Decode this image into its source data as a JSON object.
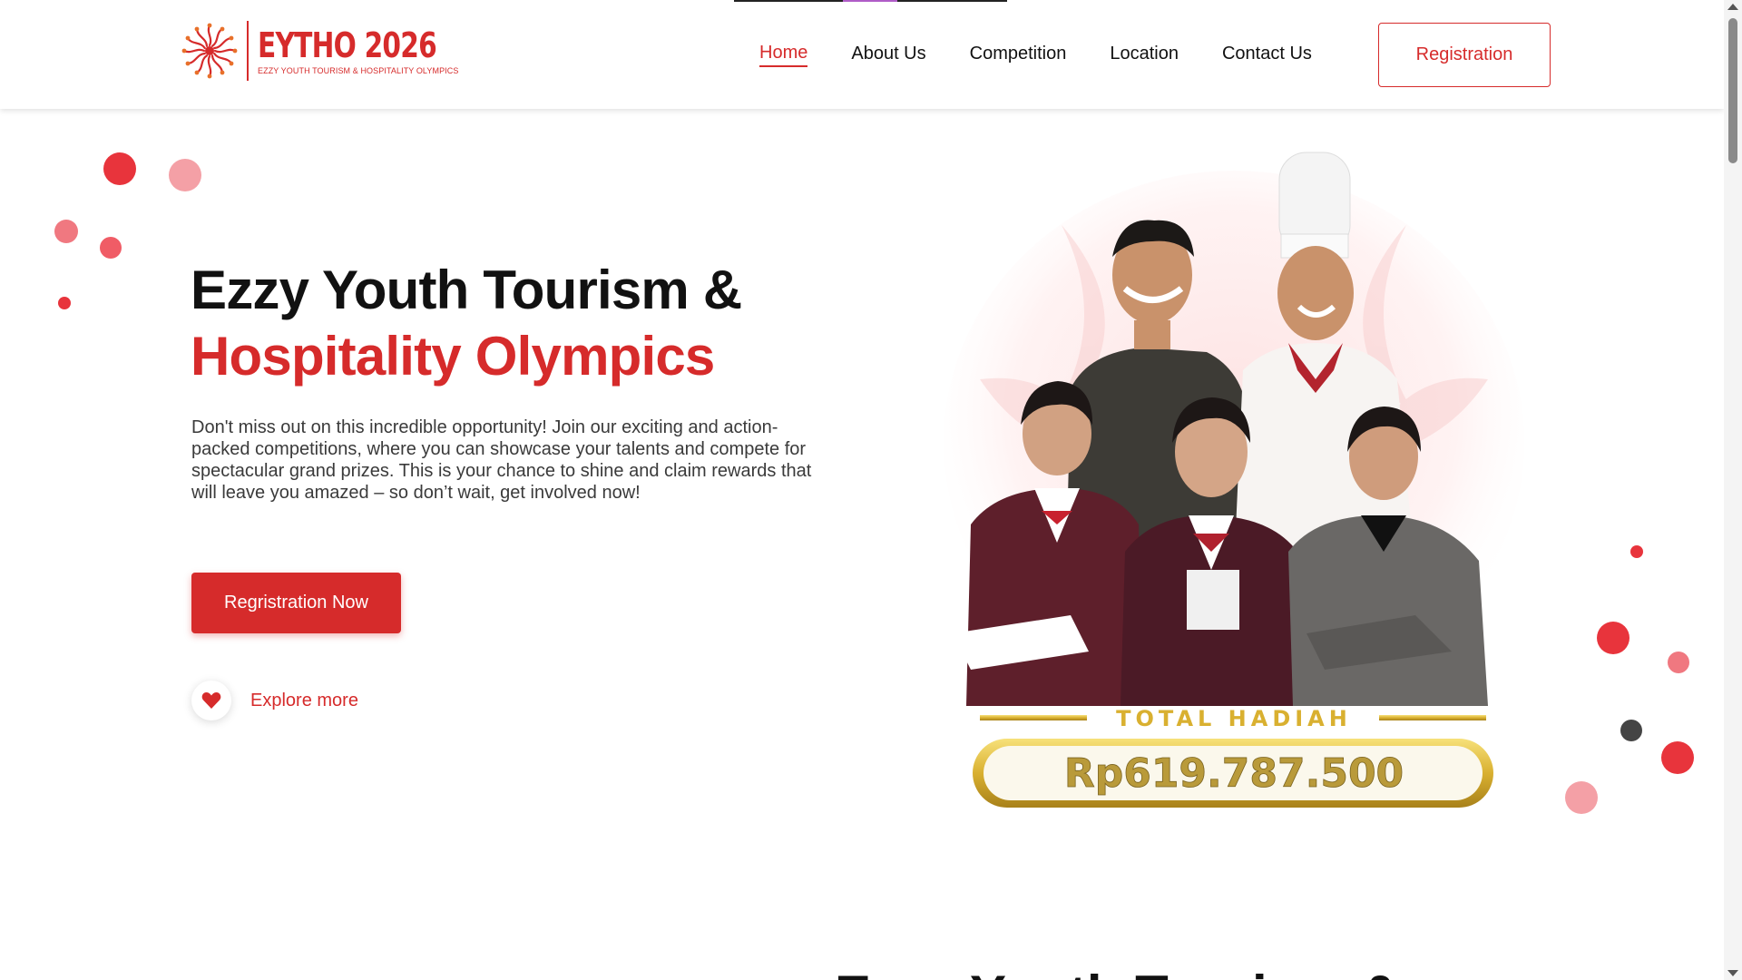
{
  "header": {
    "logo_name": "EYTHO 2026",
    "logo_tagline": "EZZY YOUTH TOURISM & HOSPITALITY OLYMPICS",
    "nav": [
      {
        "label": "Home",
        "active": true
      },
      {
        "label": "About Us",
        "active": false
      },
      {
        "label": "Competition",
        "active": false
      },
      {
        "label": "Location",
        "active": false
      },
      {
        "label": "Contact Us",
        "active": false
      }
    ],
    "registration_label": "Registration"
  },
  "hero": {
    "title_line1": "Ezzy Youth Tourism &",
    "title_line2": "Hospitality Olympics",
    "description": "Don't miss out on this incredible opportunity! Join our exciting and action-packed competitions, where you can showcase your talents and compete for spectacular grand prizes. This is your chance to shine and claim rewards that will leave you amazed – so don’t wait, get involved now!",
    "cta_label": "Regristration Now",
    "explore_label": "Explore more",
    "prize_label": "TOTAL HADIAH",
    "prize_value": "Rp619.787.500"
  },
  "next_section": {
    "peek_title": "Ezzy Youth Tourism &"
  },
  "icons": {
    "logo": "flower-emblem-icon",
    "explore": "heart-icon"
  },
  "colors": {
    "brand_red": "#d62b2b",
    "pink": "#f4a0a6",
    "dark_dot": "#444444",
    "gold": "#d9b030"
  }
}
